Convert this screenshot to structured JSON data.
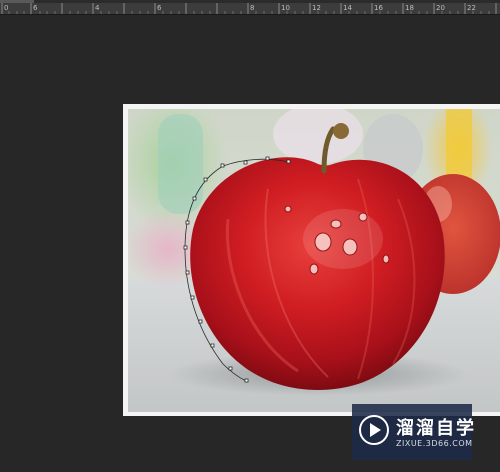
{
  "ruler": {
    "labels": [
      "0",
      "6",
      "4",
      "6",
      "8",
      "10",
      "12",
      "14",
      "16",
      "18",
      "20",
      "22"
    ]
  },
  "image": {
    "subject": "red-apple-photo",
    "selection_tool": "pen-path-around-apple"
  },
  "watermark": {
    "title": "溜溜自学",
    "url": "ZIXUE.3D66.COM"
  },
  "colors": {
    "workspace": "#272727",
    "ruler": "#3c3c3c",
    "apple_red": "#c8161d",
    "watermark_bg": "#1e2a48"
  }
}
